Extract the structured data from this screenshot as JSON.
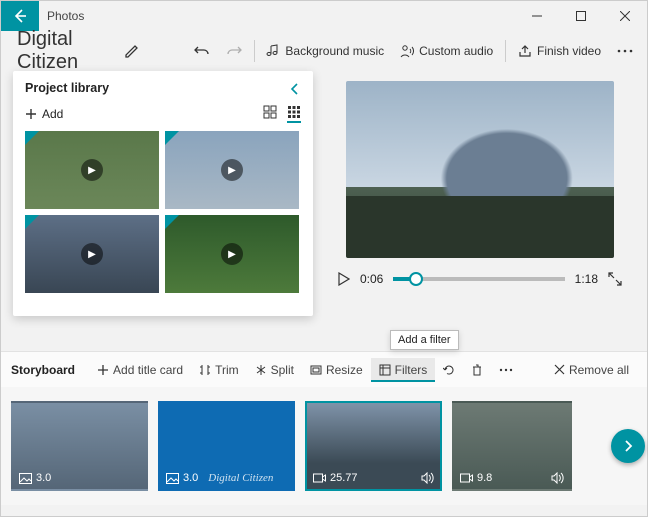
{
  "app": {
    "title": "Photos"
  },
  "header": {
    "project_name": "Digital Citizen",
    "bg_music": "Background music",
    "custom_audio": "Custom audio",
    "finish": "Finish video"
  },
  "library": {
    "title": "Project library",
    "add_label": "Add"
  },
  "preview": {
    "current_time": "0:06",
    "total_time": "1:18"
  },
  "tooltip": {
    "filters": "Add a filter"
  },
  "storyboard": {
    "title": "Storyboard",
    "add_title_card": "Add title card",
    "trim": "Trim",
    "split": "Split",
    "resize": "Resize",
    "filters": "Filters",
    "remove_all": "Remove all",
    "clips": [
      {
        "duration": "3.0",
        "type": "image"
      },
      {
        "duration": "3.0",
        "type": "image",
        "caption": "Digital Citizen"
      },
      {
        "duration": "25.77",
        "type": "video",
        "audio": true,
        "selected": true
      },
      {
        "duration": "9.8",
        "type": "video",
        "audio": true
      }
    ]
  }
}
